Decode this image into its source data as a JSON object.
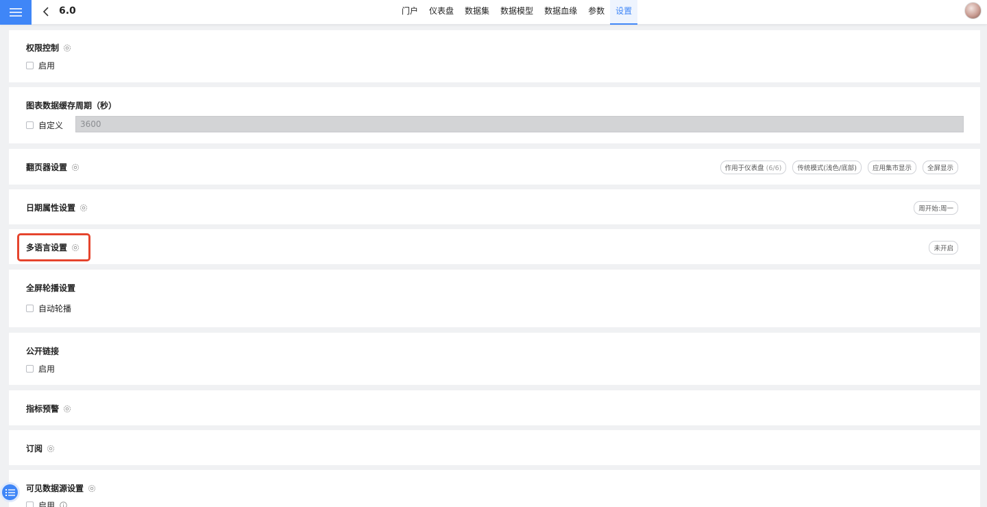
{
  "header": {
    "title": "6.0",
    "nav": [
      {
        "label": "门户",
        "active": false
      },
      {
        "label": "仪表盘",
        "active": false
      },
      {
        "label": "数据集",
        "active": false
      },
      {
        "label": "数据模型",
        "active": false
      },
      {
        "label": "数据血缘",
        "active": false
      },
      {
        "label": "参数",
        "active": false
      },
      {
        "label": "设置",
        "active": true
      }
    ]
  },
  "sections": {
    "permission": {
      "title": "权限控制",
      "checkbox_label": "启用"
    },
    "cache": {
      "title": "图表数据缓存周期（秒）",
      "checkbox_label": "自定义",
      "value": "3600"
    },
    "pager": {
      "title": "翻页器设置",
      "tags": [
        {
          "label": "作用于仪表盘",
          "extra": "(6/6)"
        },
        {
          "label": "传统模式(浅色/底部)",
          "extra": ""
        },
        {
          "label": "应用集市显示",
          "extra": ""
        },
        {
          "label": "全屏显示",
          "extra": ""
        }
      ]
    },
    "date": {
      "title": "日期属性设置",
      "tag": "周开始:周一"
    },
    "language": {
      "title": "多语言设置",
      "tag": "未开启"
    },
    "carousel": {
      "title": "全屏轮播设置",
      "checkbox_label": "自动轮播"
    },
    "public_link": {
      "title": "公开链接",
      "checkbox_label": "启用"
    },
    "alert": {
      "title": "指标预警"
    },
    "subscribe": {
      "title": "订阅"
    },
    "datasource": {
      "title": "可见数据源设置",
      "checkbox_label": "启用"
    }
  },
  "colors": {
    "accent": "#3f86f7",
    "highlight": "#e5442d"
  }
}
